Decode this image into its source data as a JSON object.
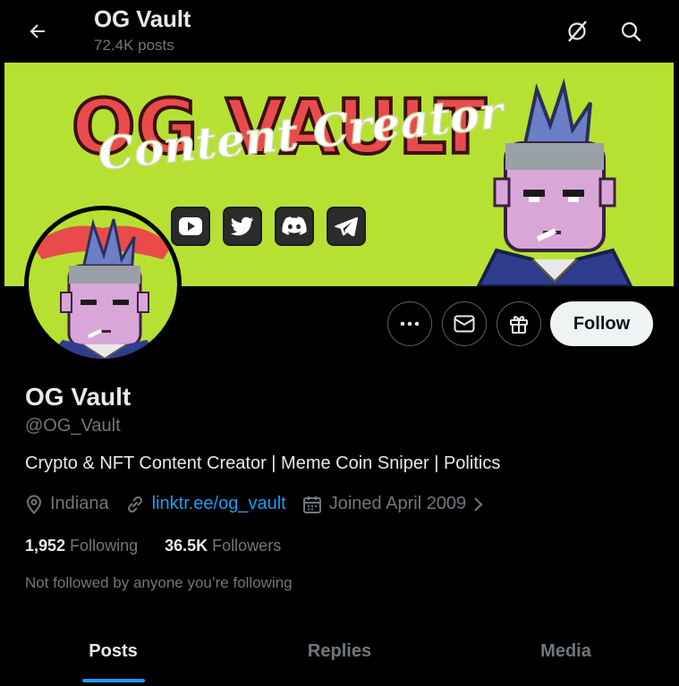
{
  "header": {
    "title": "OG Vault",
    "post_count": "72.4K posts"
  },
  "banner": {
    "title": "OG VAULT",
    "subtitle": "Content Creator",
    "social_icons": [
      "youtube-icon",
      "twitter-icon",
      "discord-icon",
      "telegram-icon"
    ]
  },
  "actions": {
    "follow_label": "Follow"
  },
  "profile": {
    "display_name": "OG Vault",
    "handle": "@OG_Vault",
    "bio": "Crypto & NFT Content Creator | Meme Coin Sniper | Politics",
    "location": "Indiana",
    "website": "linktr.ee/og_vault",
    "joined": "Joined April 2009",
    "following_count": "1,952",
    "following_label": "Following",
    "followers_count": "36.5K",
    "followers_label": "Followers",
    "not_followed_text": "Not followed by anyone you’re following"
  },
  "tabs": [
    {
      "label": "Posts",
      "active": true
    },
    {
      "label": "Replies",
      "active": false
    },
    {
      "label": "Media",
      "active": false
    }
  ],
  "colors": {
    "banner_bg": "#b6e132",
    "accent": "#1d9bf0",
    "banner_title": "#e94b4b"
  }
}
